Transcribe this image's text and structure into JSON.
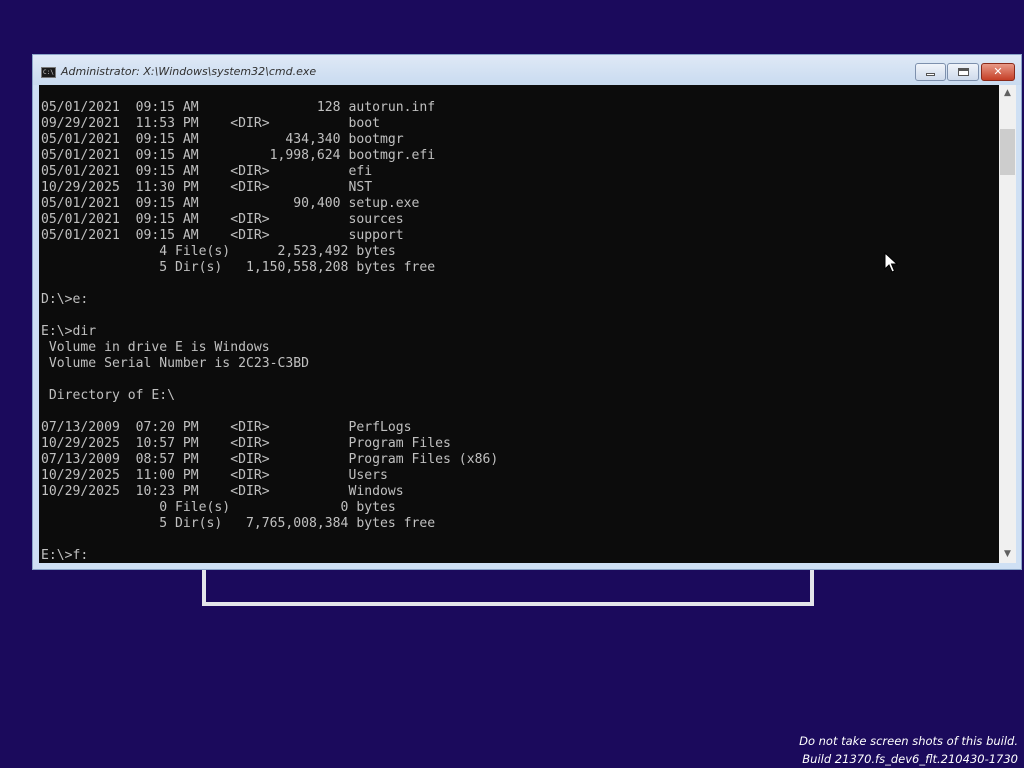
{
  "window": {
    "title": "Administrator: X:\\Windows\\system32\\cmd.exe",
    "icon": "console-app-icon",
    "icon_text": "C:\\",
    "buttons": {
      "minimize": "minimize-icon",
      "maximize": "maximize-icon",
      "close": "close-icon",
      "close_glyph": "✕"
    }
  },
  "console": {
    "lines": [
      "05/01/2021  09:15 AM               128 autorun.inf",
      "09/29/2021  11:53 PM    <DIR>          boot",
      "05/01/2021  09:15 AM           434,340 bootmgr",
      "05/01/2021  09:15 AM         1,998,624 bootmgr.efi",
      "05/01/2021  09:15 AM    <DIR>          efi",
      "10/29/2025  11:30 PM    <DIR>          NST",
      "05/01/2021  09:15 AM            90,400 setup.exe",
      "05/01/2021  09:15 AM    <DIR>          sources",
      "05/01/2021  09:15 AM    <DIR>          support",
      "               4 File(s)      2,523,492 bytes",
      "               5 Dir(s)   1,150,558,208 bytes free",
      "",
      "D:\\>e:",
      "",
      "E:\\>dir",
      " Volume in drive E is Windows",
      " Volume Serial Number is 2C23-C3BD",
      "",
      " Directory of E:\\",
      "",
      "07/13/2009  07:20 PM    <DIR>          PerfLogs",
      "10/29/2025  10:57 PM    <DIR>          Program Files",
      "07/13/2009  08:57 PM    <DIR>          Program Files (x86)",
      "10/29/2025  11:00 PM    <DIR>          Users",
      "10/29/2025  10:23 PM    <DIR>          Windows",
      "               0 File(s)              0 bytes",
      "               5 Dir(s)   7,765,008,384 bytes free",
      "",
      "E:\\>f:"
    ],
    "colors": {
      "background": "#0c0c0c",
      "foreground": "#c0c0c0"
    }
  },
  "scrollbar": {
    "up_arrow": "▲",
    "down_arrow": "▼"
  },
  "watermark": {
    "line1": "Do not take screen shots of this build.",
    "line2": "Build 21370.fs_dev6_flt.210430-1730"
  },
  "desktop": {
    "background": "#1b0a5c"
  }
}
